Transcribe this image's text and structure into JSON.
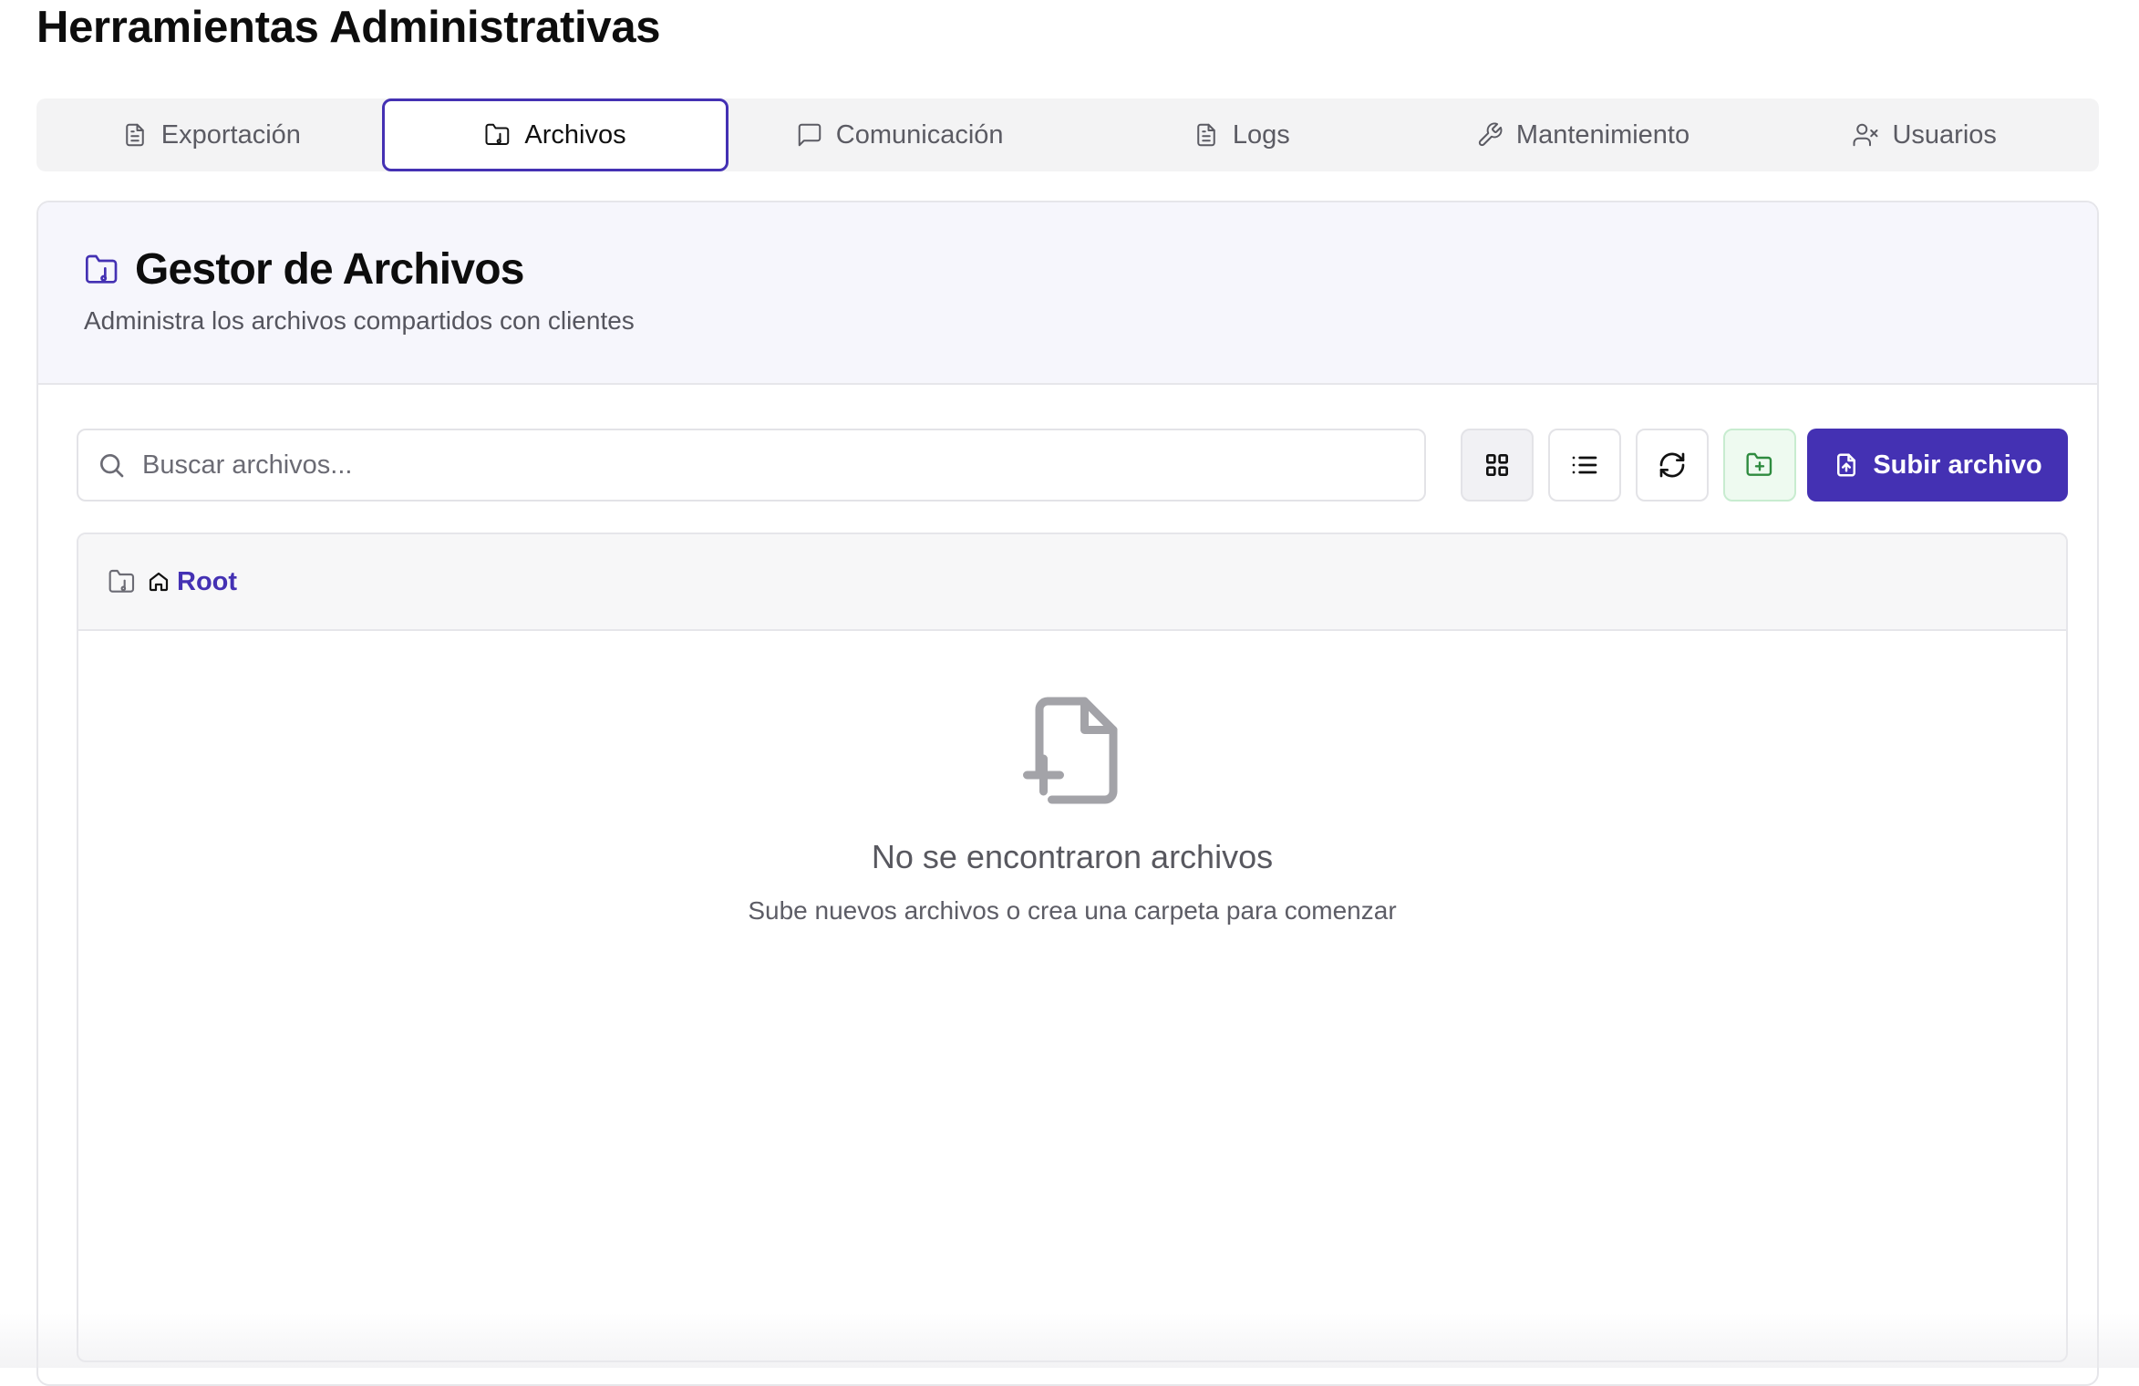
{
  "page": {
    "title": "Herramientas Administrativas"
  },
  "tabs": [
    {
      "label": "Exportación",
      "icon": "document-icon",
      "active": false
    },
    {
      "label": "Archivos",
      "icon": "folder-icon",
      "active": true
    },
    {
      "label": "Comunicación",
      "icon": "message-icon",
      "active": false
    },
    {
      "label": "Logs",
      "icon": "document-icon",
      "active": false
    },
    {
      "label": "Mantenimiento",
      "icon": "wrench-icon",
      "active": false
    },
    {
      "label": "Usuarios",
      "icon": "user-x-icon",
      "active": false
    }
  ],
  "file_manager": {
    "title": "Gestor de Archivos",
    "subtitle": "Administra los archivos compartidos con clientes",
    "search": {
      "placeholder": "Buscar archivos...",
      "value": ""
    },
    "upload_label": "Subir archivo",
    "breadcrumb": {
      "root_label": "Root"
    },
    "empty": {
      "title": "No se encontraron archivos",
      "description": "Sube nuevos archivos o crea una carpeta para comenzar"
    }
  },
  "colors": {
    "accent": "#4431b3",
    "new_folder_green": "#2e8b3f",
    "muted_icon": "#a3a3a8"
  }
}
